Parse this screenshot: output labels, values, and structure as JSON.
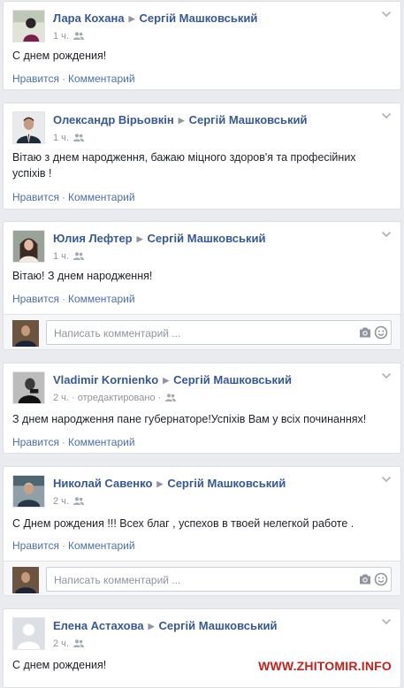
{
  "target_name": "Сергій Машковський",
  "actions": {
    "like": "Нравится",
    "separator": "·",
    "comment": "Комментарий"
  },
  "comment_placeholder": "Написать комментарий ...",
  "posts": [
    {
      "author": "Лара Кохана",
      "time": "1 ч.",
      "text": "С днем рождения!"
    },
    {
      "author": "Олександр Вірьовкін",
      "time": "1 ч.",
      "text": "Вітаю з днем народження, бажаю міцного здоров'я та професійних успіхів !"
    },
    {
      "author": "Юлия Лефтер",
      "time": "1 ч.",
      "text": "Вітаю! З днем народження!"
    },
    {
      "author": "Vladimir Kornienko",
      "time": "2 ч.",
      "edited": "· отредактировано ·",
      "text": "З днем народження пане губернаторе!Успіхів Вам у всіх починаннях!"
    },
    {
      "author": "Николай Савенко",
      "time": "2 ч.",
      "text": "С Днем рождения !!! Всех благ , успехов в твоей нелегкой работе ."
    },
    {
      "author": "Елена Астахова",
      "time": "2 ч.",
      "text": "С днем рождения!"
    }
  ],
  "watermark": "WWW.ZHITOMIR.INFO",
  "icons": {
    "audience": "friends-icon",
    "chevron": "chevron-down-icon",
    "camera": "camera-icon",
    "emoji": "smiley-icon"
  },
  "colors": {
    "link": "#365899",
    "action": "#4b6eac",
    "meta": "#90949c",
    "watermark": "#c8201a"
  }
}
